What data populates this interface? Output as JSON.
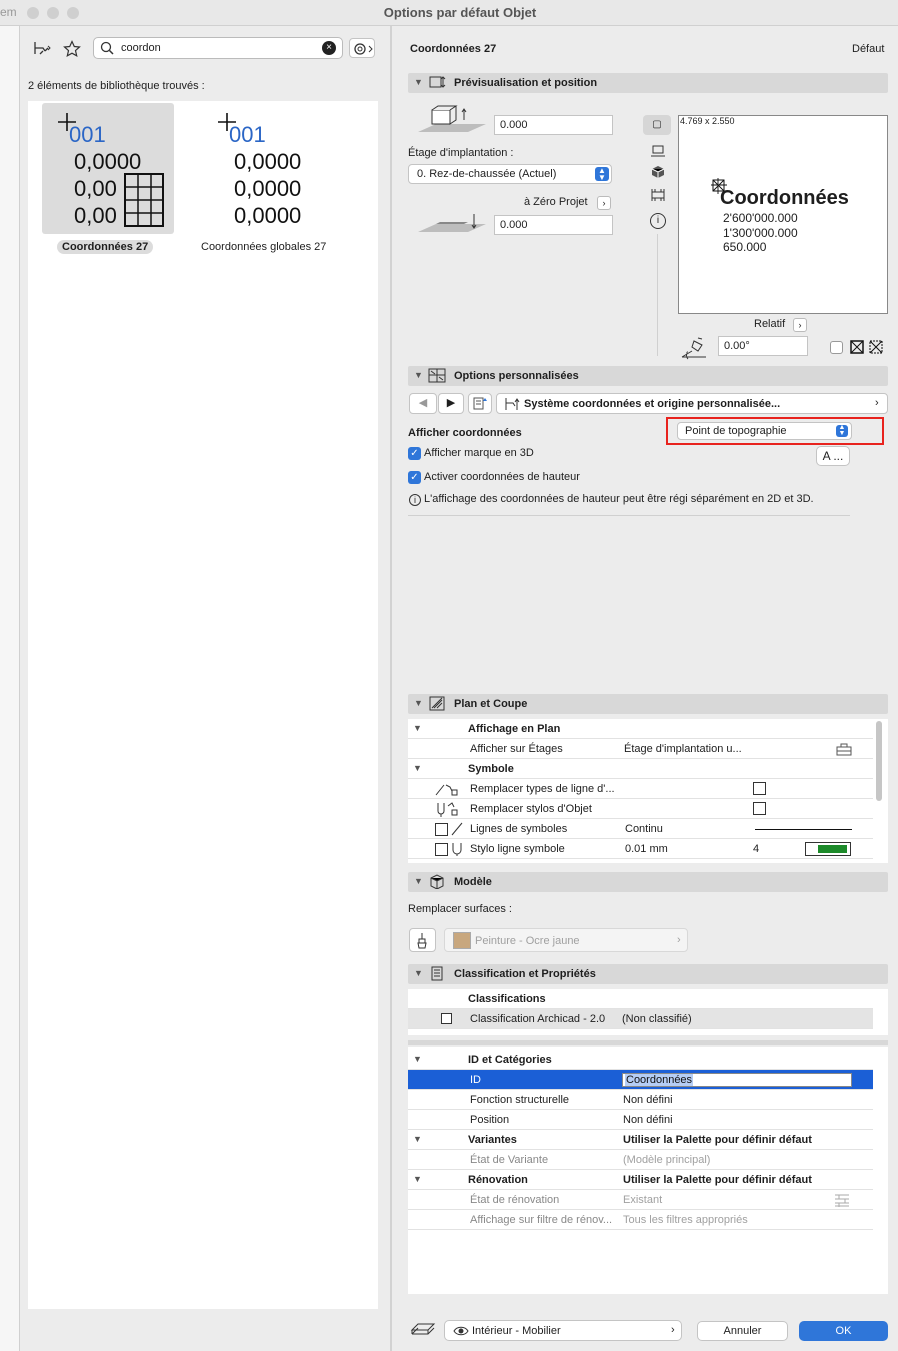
{
  "window": {
    "title": "Options par défaut Objet",
    "left_edge_text": "em"
  },
  "left": {
    "search_value": "coordon",
    "found_text": "2 éléments de bibliothèque trouvés :",
    "items": [
      {
        "name": "Coordonnées 27",
        "lines": [
          "001",
          "0,0000",
          "0,00",
          "0,00"
        ]
      },
      {
        "name": "Coordonnées globales 27",
        "lines": [
          "001",
          "0,0000",
          "0,0000",
          "0,0000"
        ]
      }
    ]
  },
  "header": {
    "title": "Coordonnées 27",
    "default": "Défaut"
  },
  "preview": {
    "section": "Prévisualisation et position",
    "offset1": "0.000",
    "story_label": "Étage d'implantation :",
    "story_value": "0. Rez-de-chaussée (Actuel)",
    "zero_label": "à Zéro Projet",
    "offset2": "0.000",
    "dims": "4.769 x 2.550",
    "preview_title": "Coordonnées",
    "preview_lines": [
      "2'600'000.000",
      "1'300'000.000",
      "650.000"
    ],
    "relatif": "Relatif",
    "angle": "0.00°"
  },
  "custom": {
    "section": "Options personnalisées",
    "system_label": "Système coordonnées et origine personnalisée...",
    "afficher_label": "Afficher coordonnées",
    "afficher_value": "Point de topographie",
    "check1": "Afficher marque en 3D",
    "check2": "Activer coordonnées de hauteur",
    "info": "L'affichage des coordonnées de hauteur peut être régi séparément en 2D et 3D.",
    "font_btn": "A ..."
  },
  "plan": {
    "section": "Plan et Coupe",
    "group1": "Affichage en Plan",
    "r1_label": "Afficher sur Étages",
    "r1_value": "Étage d'implantation u...",
    "group2": "Symbole",
    "r2_label": "Remplacer types de ligne d'...",
    "r3_label": "Remplacer stylos d'Objet",
    "r4_label": "Lignes de symboles",
    "r4_value": "Continu",
    "r5_label": "Stylo ligne symbole",
    "r5_value": "0.01 mm",
    "r5_num": "4",
    "pen_color": "#1d8a2a"
  },
  "modele": {
    "section": "Modèle",
    "surfaces_label": "Remplacer surfaces :",
    "surface_value": "Peinture - Ocre jaune",
    "surface_color": "#c8a77e"
  },
  "classif": {
    "section": "Classification et Propriétés",
    "classifications": "Classifications",
    "class_label": "Classification Archicad - 2.0",
    "class_value": "(Non classifié)",
    "id_group": "ID et Catégories",
    "id_label": "ID",
    "id_value": "Coordonnées",
    "fs_label": "Fonction structurelle",
    "fs_value": "Non défini",
    "pos_label": "Position",
    "pos_value": "Non défini",
    "var_label": "Variantes",
    "var_value": "Utiliser la Palette pour définir défaut",
    "etat_var_label": "État de Variante",
    "etat_var_value": "(Modèle principal)",
    "renov_label": "Rénovation",
    "renov_value": "Utiliser la Palette pour définir défaut",
    "etat_renov_label": "État de rénovation",
    "etat_renov_value": "Existant",
    "filtre_label": "Affichage sur filtre de rénov...",
    "filtre_value": "Tous les filtres appropriés"
  },
  "footer": {
    "layer": "Intérieur - Mobilier",
    "cancel": "Annuler",
    "ok": "OK"
  },
  "colors": {
    "accent": "#2f76d9",
    "selected_row": "#1b5fd6",
    "highlight": "#e8231e",
    "ok": "#2f76d9"
  }
}
